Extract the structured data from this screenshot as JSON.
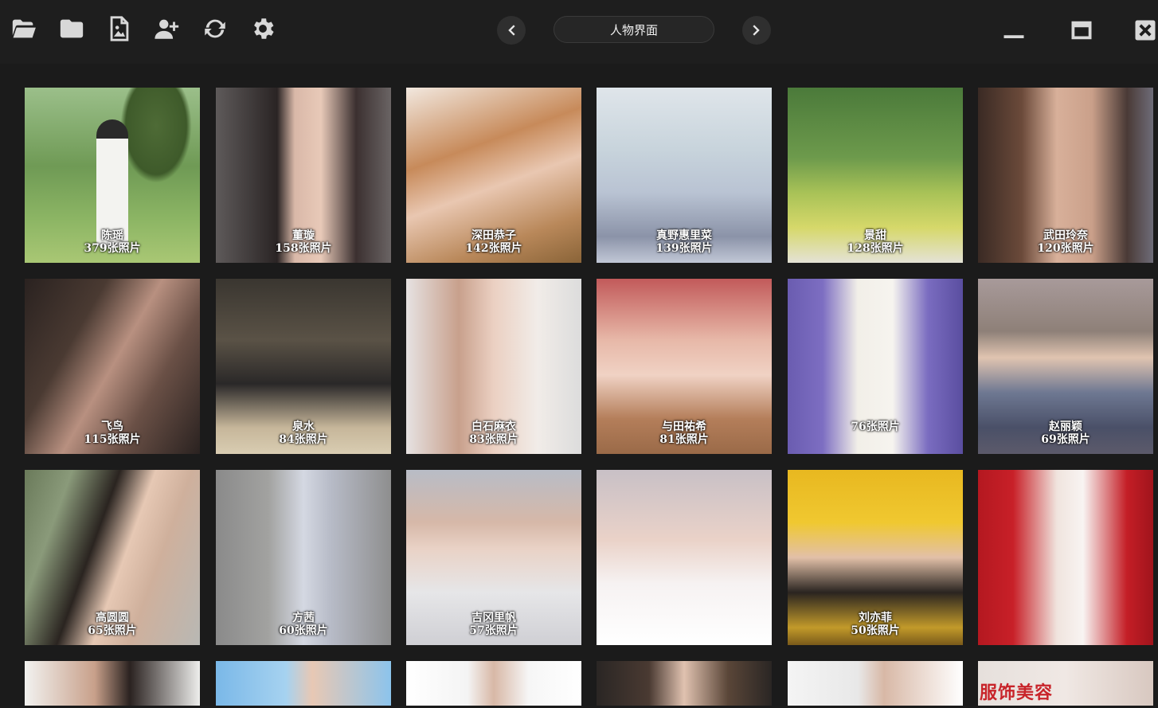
{
  "header": {
    "title": "人物界面",
    "tools": [
      "folder-open-icon",
      "folder-icon",
      "image-file-icon",
      "add-user-icon",
      "refresh-icon",
      "settings-icon"
    ]
  },
  "people": [
    {
      "name": "陈瑶",
      "count": "379张照片"
    },
    {
      "name": "董璇",
      "count": "158张照片"
    },
    {
      "name": "深田恭子",
      "count": "142张照片"
    },
    {
      "name": "真野惠里菜",
      "count": "139张照片"
    },
    {
      "name": "景甜",
      "count": "128张照片"
    },
    {
      "name": "武田玲奈",
      "count": "120张照片"
    },
    {
      "name": "飞鸟",
      "count": "115张照片"
    },
    {
      "name": "泉水",
      "count": "84张照片"
    },
    {
      "name": "白石麻衣",
      "count": "83张照片"
    },
    {
      "name": "与田祐希",
      "count": "81张照片"
    },
    {
      "name": "",
      "count": "76张照片"
    },
    {
      "name": "赵丽颖",
      "count": "69张照片"
    },
    {
      "name": "高圆圆",
      "count": "65张照片"
    },
    {
      "name": "方茜",
      "count": "60张照片"
    },
    {
      "name": "吉冈里帆",
      "count": "57张照片"
    },
    {
      "name": "",
      "count": ""
    },
    {
      "name": "刘亦菲",
      "count": "50张照片"
    },
    {
      "name": "",
      "count": ""
    }
  ],
  "partial_row_text": "服饰美容",
  "colors": {
    "background": "#1b1b1b",
    "accent": "#e6e6e6"
  }
}
